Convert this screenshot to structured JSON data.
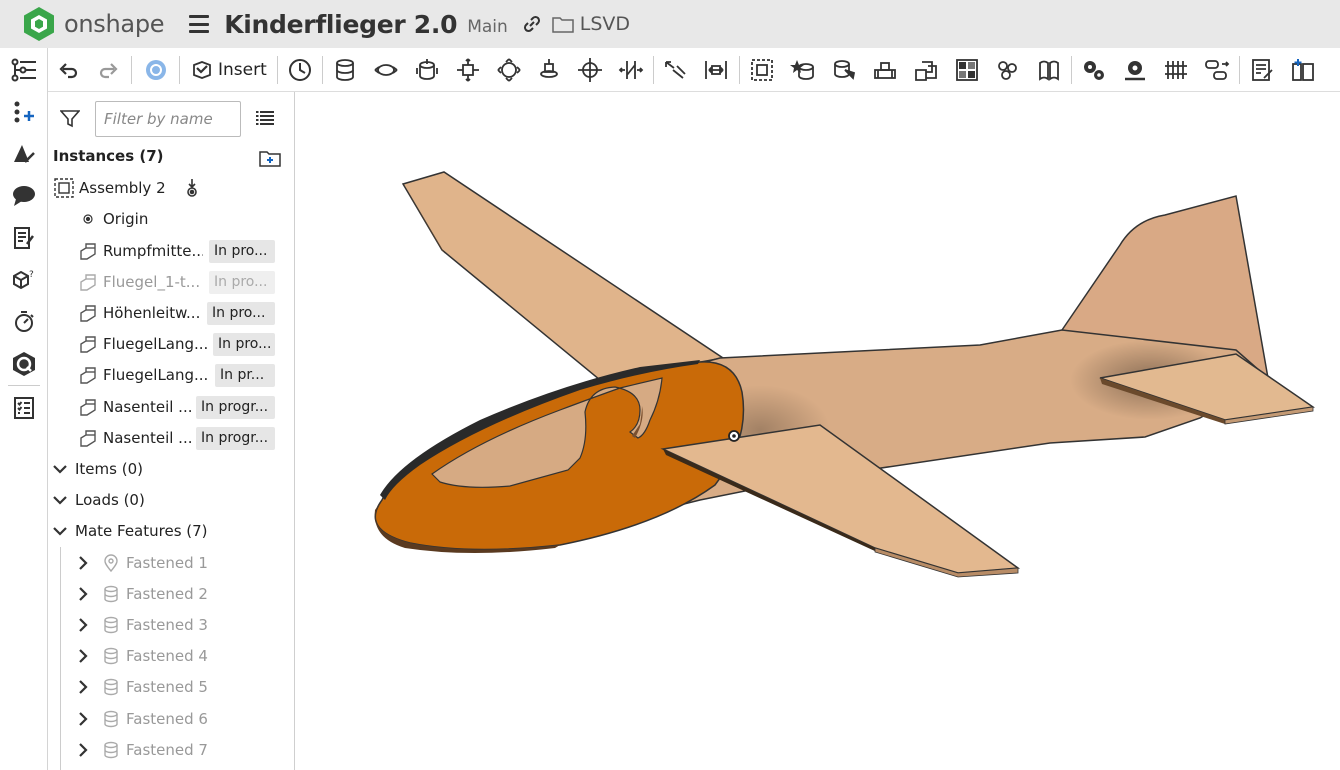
{
  "app": {
    "name": "onshape",
    "document_title": "Kinderflieger 2.0",
    "branch": "Main",
    "folder": "LSVD"
  },
  "toolbar": {
    "insert_label": "Insert"
  },
  "panel": {
    "filter_placeholder": "Filter by name",
    "instances_header": "Instances (7)",
    "assembly": "Assembly 2",
    "origin": "Origin",
    "instances": [
      {
        "name": "Rumpfmitte...",
        "status": "In pro..."
      },
      {
        "name": "Fluegel_1-t...",
        "status": "In pro..."
      },
      {
        "name": "Höhenleitw...",
        "status": "In pro..."
      },
      {
        "name": "FluegelLang...",
        "status": "In pro..."
      },
      {
        "name": "FluegelLang...",
        "status": "In pr..."
      },
      {
        "name": "Nasenteil ...",
        "status": "In progr..."
      },
      {
        "name": "Nasenteil ...",
        "status": "In progr..."
      }
    ],
    "items_header": "Items (0)",
    "loads_header": "Loads (0)",
    "mates_header": "Mate Features (7)",
    "mates": [
      "Fastened 1",
      "Fastened 2",
      "Fastened 3",
      "Fastened 4",
      "Fastened 5",
      "Fastened 6",
      "Fastened 7"
    ]
  },
  "colors": {
    "wood": "#dfb48a",
    "nose": "#c96a08",
    "brand_green": "#39a84a"
  }
}
